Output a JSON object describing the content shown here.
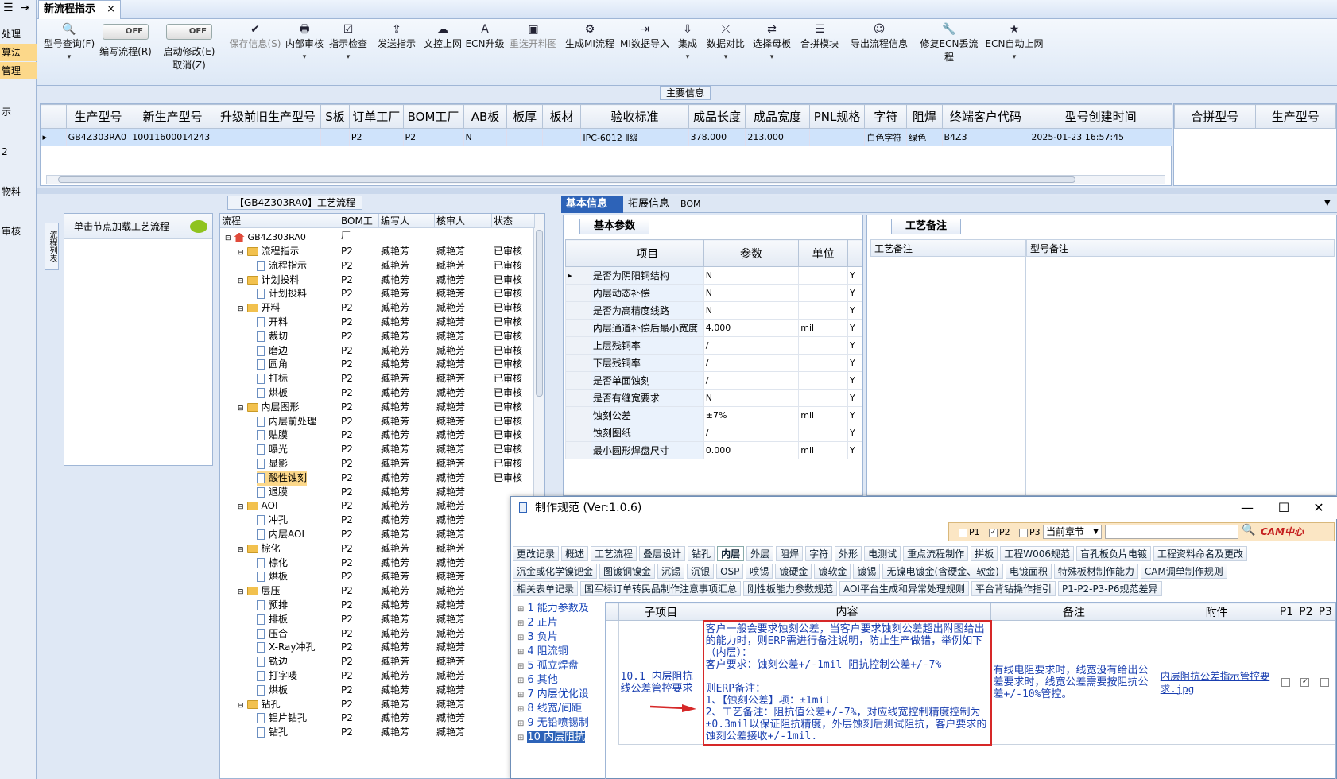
{
  "left_sidebar": {
    "items": [
      {
        "label": "处理",
        "highlight": false
      },
      {
        "label": "算法",
        "highlight": true
      },
      {
        "label": "管理",
        "highlight": true
      },
      {
        "label": "示",
        "highlight": false
      },
      {
        "label": "2",
        "highlight": false
      },
      {
        "label": "物料",
        "highlight": false
      },
      {
        "label": "审核",
        "highlight": false
      }
    ]
  },
  "window": {
    "tab_title": "新流程指示"
  },
  "toolbar": {
    "items": [
      {
        "label": "型号查询(F)",
        "icon": "search-icon",
        "glyph": "🔍"
      },
      {
        "label": "编写流程(R)",
        "toggle": "OFF"
      },
      {
        "label": "启动修改(E)",
        "label2": "取消(Z)",
        "toggle": "OFF"
      },
      {
        "label": "保存信息(S)",
        "glyph": "✔",
        "disabled": true
      },
      {
        "label": "内部审核",
        "glyph": "🖶"
      },
      {
        "label": "指示检查",
        "glyph": "☑"
      },
      {
        "label": "发送指示",
        "glyph": "⇪"
      },
      {
        "label": "文控上网",
        "glyph": "☁"
      },
      {
        "label": "ECN升级",
        "glyph": "A"
      },
      {
        "label": "重选开料图",
        "glyph": "▣",
        "disabled": true
      },
      {
        "label": "生成MI流程",
        "glyph": "⚙"
      },
      {
        "label": "MI数据导入",
        "glyph": "⇥"
      },
      {
        "label": "集成",
        "glyph": "⇩"
      },
      {
        "label": "数据对比",
        "glyph": "⤫"
      },
      {
        "label": "选择母板",
        "glyph": "⇄"
      },
      {
        "label": "合拼模块",
        "glyph": "☰"
      },
      {
        "label": "导出流程信息",
        "glyph": "☺"
      },
      {
        "label": "修复ECN丢流程",
        "glyph": "🔧"
      },
      {
        "label": "ECN自动上网",
        "glyph": "★"
      }
    ]
  },
  "main_info": {
    "section_label": "主要信息",
    "columns": [
      "生产型号",
      "新生产型号",
      "升级前旧生产型号",
      "S板",
      "订单工厂",
      "BOM工厂",
      "AB板",
      "板厚",
      "板材",
      "验收标准",
      "成品长度",
      "成品宽度",
      "PNL规格",
      "字符",
      "阻焊",
      "终端客户代码",
      "型号创建时间"
    ],
    "row": [
      "GB4Z303RA0",
      "10011600014243",
      "",
      "",
      "P2",
      "P2",
      "N",
      "",
      "",
      "IPC-6012 Ⅱ级",
      "378.000",
      "213.000",
      "",
      "白色字符",
      "绿色",
      "B4Z3",
      "2025-01-23 16:57:45"
    ],
    "right_columns": [
      "合拼型号",
      "生产型号"
    ]
  },
  "flow_panel": {
    "title": "【GB4Z303RA0】工艺流程",
    "side_tab": "流程列表",
    "tip": "单击节点加载工艺流程",
    "columns": [
      "流程",
      "BOM工厂",
      "编写人",
      "核审人",
      "状态"
    ],
    "root": "GB4Z303RA0",
    "rows": [
      {
        "name": "流程指示",
        "type": "folder",
        "bom": "P2",
        "author": "臧艳芳",
        "reviewer": "臧艳芳",
        "status": "已审核"
      },
      {
        "name": "流程指示",
        "type": "doc",
        "bom": "P2",
        "author": "臧艳芳",
        "reviewer": "臧艳芳",
        "status": "已审核"
      },
      {
        "name": "计划投料",
        "type": "folder",
        "bom": "P2",
        "author": "臧艳芳",
        "reviewer": "臧艳芳",
        "status": "已审核"
      },
      {
        "name": "计划投料",
        "type": "doc",
        "bom": "P2",
        "author": "臧艳芳",
        "reviewer": "臧艳芳",
        "status": "已审核"
      },
      {
        "name": "开料",
        "type": "folder",
        "bom": "P2",
        "author": "臧艳芳",
        "reviewer": "臧艳芳",
        "status": "已审核"
      },
      {
        "name": "开料",
        "type": "doc",
        "bom": "P2",
        "author": "臧艳芳",
        "reviewer": "臧艳芳",
        "status": "已审核"
      },
      {
        "name": "裁切",
        "type": "doc",
        "bom": "P2",
        "author": "臧艳芳",
        "reviewer": "臧艳芳",
        "status": "已审核"
      },
      {
        "name": "磨边",
        "type": "doc",
        "bom": "P2",
        "author": "臧艳芳",
        "reviewer": "臧艳芳",
        "status": "已审核"
      },
      {
        "name": "圆角",
        "type": "doc",
        "bom": "P2",
        "author": "臧艳芳",
        "reviewer": "臧艳芳",
        "status": "已审核"
      },
      {
        "name": "打标",
        "type": "doc",
        "bom": "P2",
        "author": "臧艳芳",
        "reviewer": "臧艳芳",
        "status": "已审核"
      },
      {
        "name": "烘板",
        "type": "doc",
        "bom": "P2",
        "author": "臧艳芳",
        "reviewer": "臧艳芳",
        "status": "已审核"
      },
      {
        "name": "内层图形",
        "type": "folder",
        "bom": "P2",
        "author": "臧艳芳",
        "reviewer": "臧艳芳",
        "status": "已审核"
      },
      {
        "name": "内层前处理",
        "type": "doc",
        "bom": "P2",
        "author": "臧艳芳",
        "reviewer": "臧艳芳",
        "status": "已审核"
      },
      {
        "name": "贴膜",
        "type": "doc",
        "bom": "P2",
        "author": "臧艳芳",
        "reviewer": "臧艳芳",
        "status": "已审核"
      },
      {
        "name": "曝光",
        "type": "doc",
        "bom": "P2",
        "author": "臧艳芳",
        "reviewer": "臧艳芳",
        "status": "已审核"
      },
      {
        "name": "显影",
        "type": "doc",
        "bom": "P2",
        "author": "臧艳芳",
        "reviewer": "臧艳芳",
        "status": "已审核"
      },
      {
        "name": "酸性蚀刻",
        "type": "doc",
        "bom": "P2",
        "author": "臧艳芳",
        "reviewer": "臧艳芳",
        "status": "已审核",
        "selected": true
      },
      {
        "name": "退膜",
        "type": "doc",
        "bom": "P2",
        "author": "臧艳芳",
        "reviewer": "臧艳芳",
        "status": ""
      },
      {
        "name": "AOI",
        "type": "folder",
        "bom": "P2",
        "author": "臧艳芳",
        "reviewer": "臧艳芳",
        "status": ""
      },
      {
        "name": "冲孔",
        "type": "doc",
        "bom": "P2",
        "author": "臧艳芳",
        "reviewer": "臧艳芳",
        "status": ""
      },
      {
        "name": "内层AOI",
        "type": "doc",
        "bom": "P2",
        "author": "臧艳芳",
        "reviewer": "臧艳芳",
        "status": ""
      },
      {
        "name": "棕化",
        "type": "folder",
        "bom": "P2",
        "author": "臧艳芳",
        "reviewer": "臧艳芳",
        "status": ""
      },
      {
        "name": "棕化",
        "type": "doc",
        "bom": "P2",
        "author": "臧艳芳",
        "reviewer": "臧艳芳",
        "status": ""
      },
      {
        "name": "烘板",
        "type": "doc",
        "bom": "P2",
        "author": "臧艳芳",
        "reviewer": "臧艳芳",
        "status": ""
      },
      {
        "name": "层压",
        "type": "folder",
        "bom": "P2",
        "author": "臧艳芳",
        "reviewer": "臧艳芳",
        "status": ""
      },
      {
        "name": "预排",
        "type": "doc",
        "bom": "P2",
        "author": "臧艳芳",
        "reviewer": "臧艳芳",
        "status": ""
      },
      {
        "name": "排板",
        "type": "doc",
        "bom": "P2",
        "author": "臧艳芳",
        "reviewer": "臧艳芳",
        "status": ""
      },
      {
        "name": "压合",
        "type": "doc",
        "bom": "P2",
        "author": "臧艳芳",
        "reviewer": "臧艳芳",
        "status": ""
      },
      {
        "name": "X-Ray冲孔",
        "type": "doc",
        "bom": "P2",
        "author": "臧艳芳",
        "reviewer": "臧艳芳",
        "status": ""
      },
      {
        "name": "铣边",
        "type": "doc",
        "bom": "P2",
        "author": "臧艳芳",
        "reviewer": "臧艳芳",
        "status": ""
      },
      {
        "name": "打字唛",
        "type": "doc",
        "bom": "P2",
        "author": "臧艳芳",
        "reviewer": "臧艳芳",
        "status": ""
      },
      {
        "name": "烘板",
        "type": "doc",
        "bom": "P2",
        "author": "臧艳芳",
        "reviewer": "臧艳芳",
        "status": ""
      },
      {
        "name": "钻孔",
        "type": "folder",
        "bom": "P2",
        "author": "臧艳芳",
        "reviewer": "臧艳芳",
        "status": ""
      },
      {
        "name": "铝片钻孔",
        "type": "doc",
        "bom": "P2",
        "author": "臧艳芳",
        "reviewer": "臧艳芳",
        "status": ""
      },
      {
        "name": "钻孔",
        "type": "doc",
        "bom": "P2",
        "author": "臧艳芳",
        "reviewer": "臧艳芳",
        "status": ""
      }
    ]
  },
  "right_tabs": [
    "基本信息",
    "拓展信息",
    "BOM"
  ],
  "basic_params": {
    "tab": "基本参数",
    "columns": [
      "项目",
      "参数",
      "单位"
    ],
    "rows": [
      [
        "是否为阴阳铜结构",
        "N",
        "",
        "Y"
      ],
      [
        "内层动态补偿",
        "N",
        "",
        "Y"
      ],
      [
        "是否为高精度线路",
        "N",
        "",
        "Y"
      ],
      [
        "内层通道补偿后最小宽度",
        "4.000",
        "mil",
        "Y"
      ],
      [
        "上层残铜率",
        "/",
        "",
        "Y"
      ],
      [
        "下层残铜率",
        "/",
        "",
        "Y"
      ],
      [
        "是否单面蚀刻",
        "/",
        "",
        "Y"
      ],
      [
        "是否有缝宽要求",
        "N",
        "",
        "Y"
      ],
      [
        "蚀刻公差",
        "±7%",
        "mil",
        "Y"
      ],
      [
        "蚀刻图纸",
        "/",
        "",
        "Y"
      ],
      [
        "最小圆形焊盘尺寸",
        "0.000",
        "mil",
        "Y"
      ]
    ]
  },
  "process_notes": {
    "tab": "工艺备注",
    "col1": "工艺备注",
    "col2": "型号备注"
  },
  "dialog": {
    "title": "制作规范 (Ver:1.0.6)",
    "filter": {
      "p1": "P1",
      "p2": "P2",
      "p3": "P3",
      "scope": "当前章节",
      "brand": "CAM中心"
    },
    "tabs_row1": [
      "更改记录",
      "概述",
      "工艺流程",
      "叠层设计",
      "钻孔",
      "内层",
      "外层",
      "阻焊",
      "字符",
      "外形",
      "电测试",
      "重点流程制作",
      "拼板",
      "工程W006规范",
      "盲孔板负片电镀",
      "工程资料命名及更改"
    ],
    "tabs_row2": [
      "沉金或化学镍钯金",
      "图镀铜镍金",
      "沉锡",
      "沉银",
      "OSP",
      "喷锡",
      "镀硬金",
      "镀软金",
      "镀锡",
      "无镍电镀金(含硬金、软金)",
      "电镀面积",
      "特殊板材制作能力",
      "CAM调单制作规则"
    ],
    "tabs_row3": [
      "相关表单记录",
      "国军标订单转民品制作注意事项汇总",
      "刚性板能力参数规范",
      "AOI平台生成和异常处理规则",
      "平台背钻操作指引",
      "P1-P2-P3-P6规范差异"
    ],
    "tree": [
      "1 能力参数及",
      "2 正片",
      "3 负片",
      "4 阻流铜",
      "5 孤立焊盘",
      "6 其他",
      "7 内层优化设",
      "8 线宽/间距",
      "9 无铅喷锡制",
      "10 内层阻抗"
    ],
    "columns": [
      "子项目",
      "内容",
      "备注",
      "附件",
      "P1",
      "P2",
      "P3"
    ],
    "row": {
      "sub": "10.1 内层阻抗线公差管控要求",
      "content": [
        "客户一般会要求蚀刻公差，当客户要求蚀刻公差超出附图给出的能力时，则ERP需进行备注说明，防止生产做错，举例如下（内层）：",
        "客户要求：蚀刻公差+/-1mil  阻抗控制公差+/-7%",
        "",
        "则ERP备注：",
        "1、【蚀刻公差】项：±1mil",
        "2、工艺备注：阻抗值公差+/-7%，对应线宽控制精度控制为±0.3mil以保证阻抗精度，外层蚀刻后测试阻抗，客户要求的蚀刻公差接收+/-1mil."
      ],
      "remark": "有线电阻要求时，线宽没有给出公差要求时，线宽公差需要按阻抗公差+/-10%管控。",
      "attachment": "内层阻抗公差指示管控要求.jpg",
      "p1": false,
      "p2": true,
      "p3": false
    }
  },
  "colors": {
    "accent": "#2d63b8",
    "highlight": "#fcd88a",
    "red": "#d62828"
  }
}
